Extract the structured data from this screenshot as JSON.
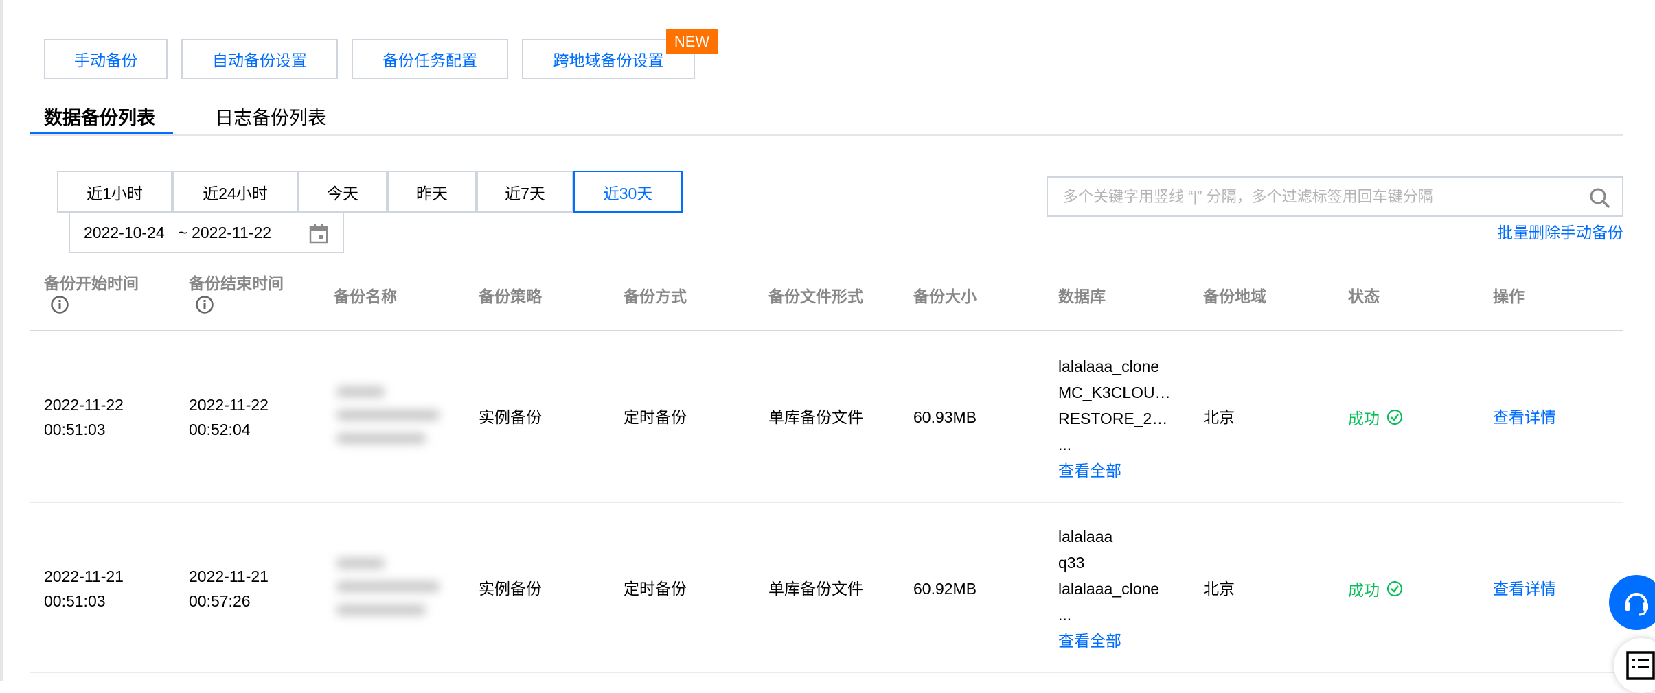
{
  "toolbar": {
    "buttons": [
      "手动备份",
      "自动备份设置",
      "备份任务配置",
      "跨地域备份设置"
    ],
    "new_badge": "NEW"
  },
  "tabs": [
    "数据备份列表",
    "日志备份列表"
  ],
  "filters": {
    "ranges": [
      "近1小时",
      "近24小时",
      "今天",
      "昨天",
      "近7天",
      "近30天"
    ],
    "active_range": "近30天",
    "date_start": "2022-10-24",
    "date_sep": "~",
    "date_end": "2022-11-22"
  },
  "search": {
    "placeholder": "多个关键字用竖线 “|” 分隔，多个过滤标签用回车键分隔"
  },
  "batch_delete": "批量删除手动备份",
  "table": {
    "headers": [
      "备份开始时间",
      "备份结束时间",
      "备份名称",
      "备份策略",
      "备份方式",
      "备份文件形式",
      "备份大小",
      "数据库",
      "备份地域",
      "状态",
      "操作"
    ],
    "rows": [
      {
        "start_date": "2022-11-22",
        "start_time": "00:51:03",
        "end_date": "2022-11-22",
        "end_time": "00:52:04",
        "strategy": "实例备份",
        "method": "定时备份",
        "file_form": "单库备份文件",
        "size": "60.93MB",
        "databases": [
          "lalalaaa_clone",
          "MC_K3CLOU…",
          "RESTORE_2…",
          "..."
        ],
        "view_all": "查看全部",
        "region": "北京",
        "status": "成功",
        "action": "查看详情"
      },
      {
        "start_date": "2022-11-21",
        "start_time": "00:51:03",
        "end_date": "2022-11-21",
        "end_time": "00:57:26",
        "strategy": "实例备份",
        "method": "定时备份",
        "file_form": "单库备份文件",
        "size": "60.92MB",
        "databases": [
          "lalalaaa",
          "q33",
          "lalalaaa_clone",
          "..."
        ],
        "view_all": "查看全部",
        "region": "北京",
        "status": "成功",
        "action": "查看详情"
      }
    ]
  },
  "colors": {
    "accent": "#006eff",
    "success": "#0abf5b",
    "badge": "#ff7200"
  }
}
